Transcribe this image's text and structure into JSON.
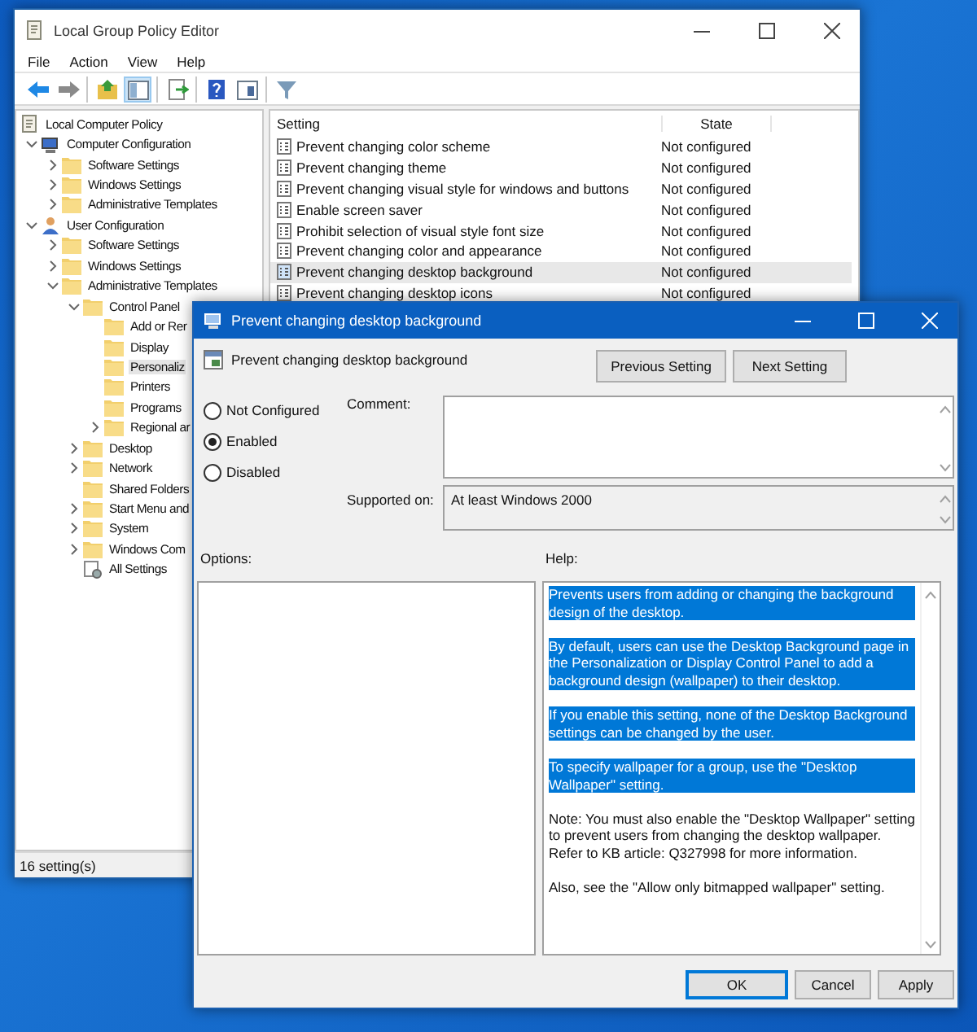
{
  "editor": {
    "title": "Local Group Policy Editor",
    "menu": [
      "File",
      "Action",
      "View",
      "Help"
    ],
    "toolbar": [
      [
        {
          "kind": "back",
          "pressed": false
        },
        {
          "kind": "forward",
          "pressed": false
        }
      ],
      [
        {
          "kind": "up",
          "pressed": false
        },
        {
          "kind": "tree",
          "pressed": true
        }
      ],
      [
        {
          "kind": "export",
          "pressed": false
        }
      ],
      [
        {
          "kind": "help",
          "pressed": false
        },
        {
          "kind": "properties",
          "pressed": false
        }
      ],
      [
        {
          "kind": "filter",
          "pressed": false
        }
      ]
    ],
    "tree": [
      {
        "label": "Local Computer Policy",
        "kind": "policy",
        "selected": false,
        "children": [
          {
            "label": "Computer Configuration",
            "kind": "computer",
            "selected": false,
            "expanded": true,
            "children": [
              {
                "label": "Software Settings",
                "kind": "folder",
                "selected": false,
                "expanded": false
              },
              {
                "label": "Windows Settings",
                "kind": "folder",
                "selected": false,
                "expanded": false
              },
              {
                "label": "Administrative Templates",
                "kind": "folder",
                "selected": false,
                "expanded": false
              }
            ]
          },
          {
            "label": "User Configuration",
            "kind": "user",
            "selected": false,
            "expanded": true,
            "children": [
              {
                "label": "Software Settings",
                "kind": "folder",
                "selected": false,
                "expanded": false
              },
              {
                "label": "Windows Settings",
                "kind": "folder",
                "selected": false,
                "expanded": false
              },
              {
                "label": "Administrative Templates",
                "kind": "folder",
                "selected": false,
                "expanded": true,
                "children": [
                  {
                    "label": "Control Panel",
                    "kind": "folder",
                    "selected": false,
                    "expanded": true,
                    "children": [
                      {
                        "label": "Add or Rer",
                        "kind": "folder",
                        "selected": false
                      },
                      {
                        "label": "Display",
                        "kind": "folder",
                        "selected": false
                      },
                      {
                        "label": "Personaliz",
                        "kind": "folder",
                        "selected": true
                      },
                      {
                        "label": "Printers",
                        "kind": "folder",
                        "selected": false
                      },
                      {
                        "label": "Programs",
                        "kind": "folder",
                        "selected": false
                      },
                      {
                        "label": "Regional ar",
                        "kind": "folder",
                        "selected": false,
                        "expanded": false
                      }
                    ]
                  },
                  {
                    "label": "Desktop",
                    "kind": "folder",
                    "selected": false,
                    "expanded": false
                  },
                  {
                    "label": "Network",
                    "kind": "folder",
                    "selected": false,
                    "expanded": false
                  },
                  {
                    "label": "Shared Folders",
                    "kind": "folder",
                    "selected": false
                  },
                  {
                    "label": "Start Menu and",
                    "kind": "folder",
                    "selected": false,
                    "expanded": false
                  },
                  {
                    "label": "System",
                    "kind": "folder",
                    "selected": false,
                    "expanded": false
                  },
                  {
                    "label": "Windows Com",
                    "kind": "folder",
                    "selected": false,
                    "expanded": false
                  },
                  {
                    "label": "All Settings",
                    "kind": "settings",
                    "selected": false
                  }
                ]
              }
            ]
          }
        ]
      }
    ],
    "columns": [
      "Setting",
      "State"
    ],
    "rows": [
      {
        "setting": "Prevent changing color scheme",
        "state": "Not configured",
        "selected": false
      },
      {
        "setting": "Prevent changing theme",
        "state": "Not configured",
        "selected": false
      },
      {
        "setting": "Prevent changing visual style for windows and buttons",
        "state": "Not configured",
        "selected": false
      },
      {
        "setting": "Enable screen saver",
        "state": "Not configured",
        "selected": false
      },
      {
        "setting": "Prohibit selection of visual style font size",
        "state": "Not configured",
        "selected": false
      },
      {
        "setting": "Prevent changing color and appearance",
        "state": "Not configured",
        "selected": false
      },
      {
        "setting": "Prevent changing desktop background",
        "state": "Not configured",
        "selected": true
      },
      {
        "setting": "Prevent changing desktop icons",
        "state": "Not configured",
        "selected": false
      }
    ],
    "status_bar": "16 setting(s)"
  },
  "dialog": {
    "title": "Prevent changing desktop background",
    "setting_name": "Prevent changing desktop background",
    "nav_buttons": [
      "Previous Setting",
      "Next Setting"
    ],
    "options": [
      {
        "label": "Not Configured",
        "selected": false
      },
      {
        "label": "Enabled",
        "selected": true
      },
      {
        "label": "Disabled",
        "selected": false
      }
    ],
    "comment_label": "Comment:",
    "supported_label": "Supported on:",
    "supported_value": "At least Windows 2000",
    "options_label": "Options:",
    "help_label": "Help:",
    "help": [
      {
        "text": "Prevents users from adding or changing the background design of the desktop.",
        "highlighted": true
      },
      {
        "text": "By default, users can use the Desktop Background page in the Personalization or Display Control Panel to add a background design (wallpaper) to their desktop.",
        "highlighted": true
      },
      {
        "text": "If you enable this setting, none of the Desktop Background settings can be changed by the user.",
        "highlighted": true
      },
      {
        "text": "To specify wallpaper for a group, use the \"Desktop Wallpaper\" setting.",
        "highlighted": true
      },
      {
        "text": "Note: You must also enable the \"Desktop Wallpaper\" setting to prevent users from changing the desktop wallpaper. Refer to KB article: Q327998 for more information.",
        "highlighted": false
      },
      {
        "text": "Also, see the \"Allow only bitmapped wallpaper\" setting.",
        "highlighted": false
      }
    ],
    "buttons": [
      {
        "label": "OK",
        "default": true
      },
      {
        "label": "Cancel",
        "default": false
      },
      {
        "label": "Apply",
        "default": false
      }
    ]
  }
}
